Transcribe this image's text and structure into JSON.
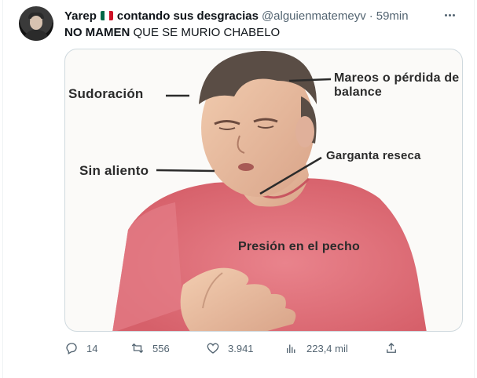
{
  "tweet": {
    "display_name": "Yarep",
    "name_suffix": "contando sus desgracias",
    "handle": "@alguienmatemeyv",
    "separator": "·",
    "time": "59min",
    "text_bold": "NO MAMEN",
    "text_rest": " QUE SE MURIO CHABELO",
    "flag_icon": "mexico-flag-icon",
    "flag_colors": [
      "#006847",
      "#ffffff",
      "#ce1126"
    ]
  },
  "media": {
    "labels": {
      "sudoracion": "Sudoración",
      "mareos": "Mareos o pérdida de balance",
      "garganta": "Garganta reseca",
      "sin_aliento": "Sin aliento",
      "presion": "Presión en el pecho"
    }
  },
  "actions": {
    "replies": "14",
    "retweets": "556",
    "likes": "3.941",
    "views": "223,4 mil",
    "reply_icon": "reply-icon",
    "retweet_icon": "retweet-icon",
    "like_icon": "heart-icon",
    "views_icon": "views-icon",
    "share_icon": "share-icon"
  },
  "colors": {
    "text": "#0f1419",
    "secondary": "#536471",
    "border": "#cfd9de"
  }
}
